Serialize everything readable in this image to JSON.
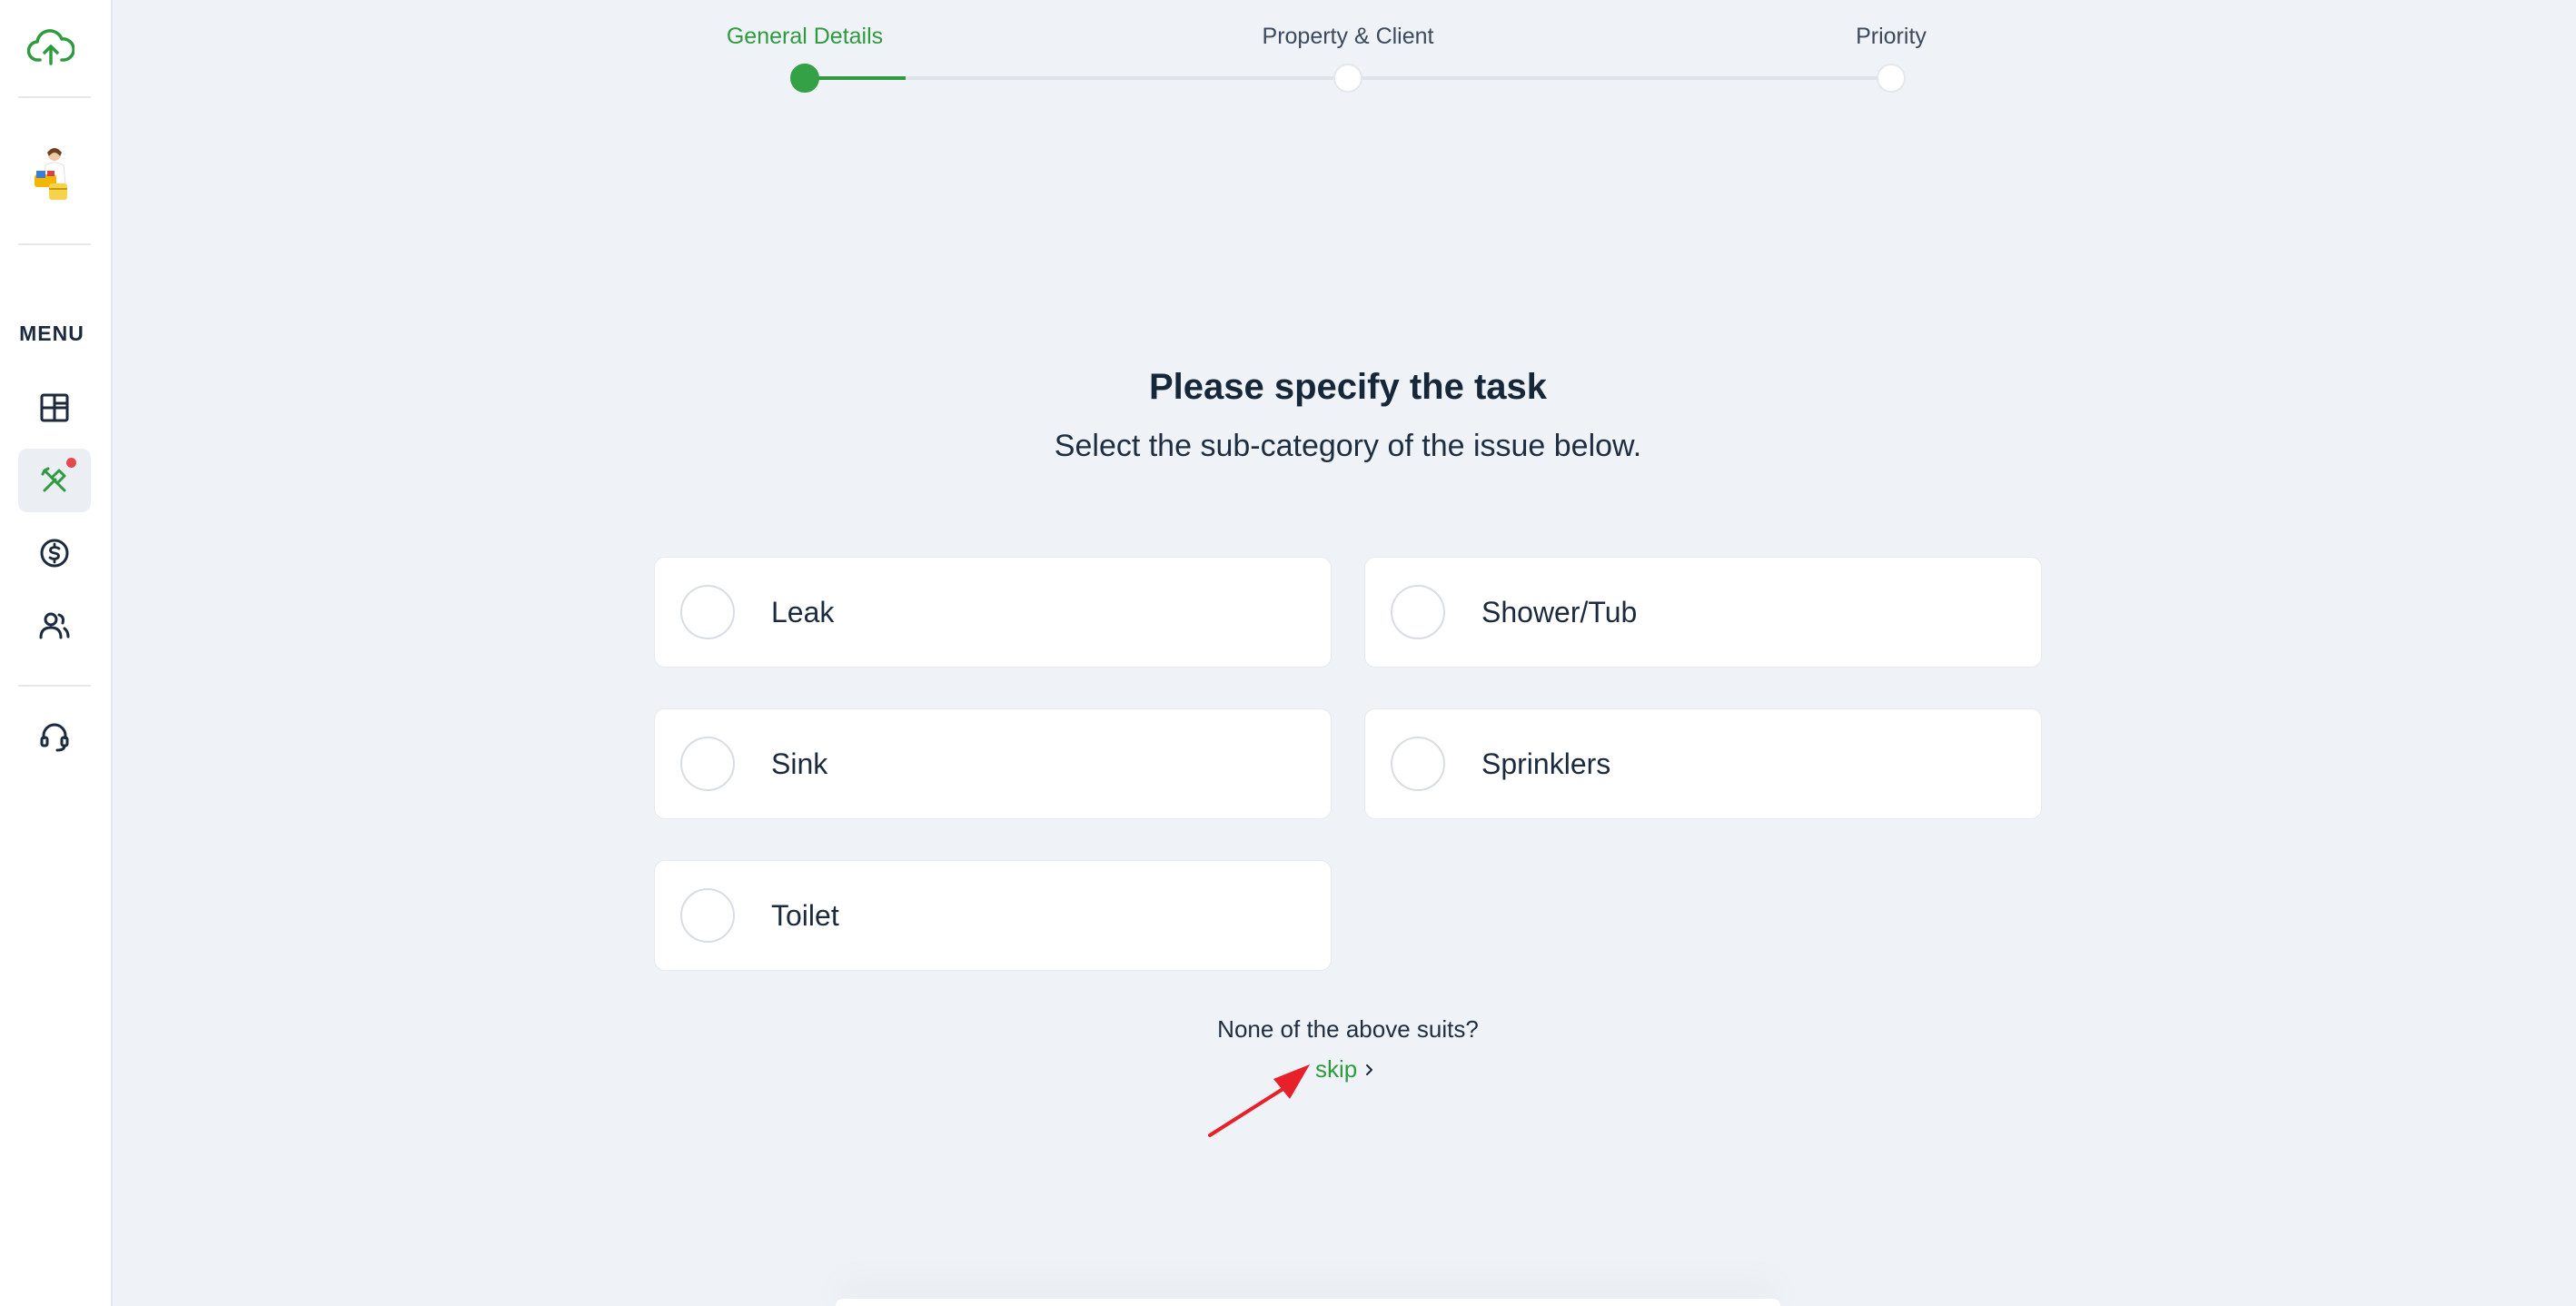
{
  "sidebar": {
    "menu_label": "MENU",
    "icons": [
      "cloud-upload-icon",
      "avatar",
      "dashboard-icon",
      "tools-icon",
      "dollar-icon",
      "users-icon",
      "headset-icon"
    ],
    "active_item": "tools",
    "notification_color": "#e5484d"
  },
  "stepper": {
    "steps": [
      {
        "label": "General Details",
        "active": true
      },
      {
        "label": "Property & Client",
        "active": false
      },
      {
        "label": "Priority",
        "active": false
      }
    ],
    "progress_fraction": 0.093
  },
  "main": {
    "title": "Please specify the task",
    "subtitle": "Select the sub-category of the issue below.",
    "options": [
      {
        "label": "Leak"
      },
      {
        "label": "Shower/Tub"
      },
      {
        "label": "Sink"
      },
      {
        "label": "Sprinklers"
      },
      {
        "label": "Toilet"
      }
    ],
    "none_text": "None of the above suits?",
    "skip_label": "skip"
  },
  "colors": {
    "accent": "#2e9b3f",
    "background": "#eff2f7",
    "annotation_arrow": "#e8202a"
  }
}
